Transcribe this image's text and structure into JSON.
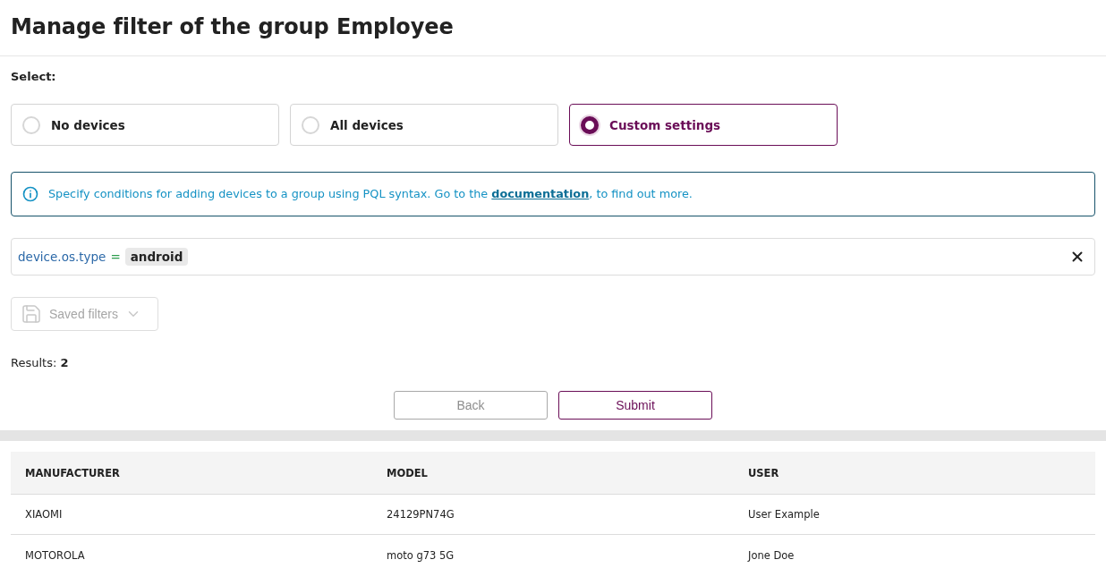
{
  "title": "Manage filter of the group Employee",
  "select_label": "Select:",
  "options": [
    {
      "label": "No devices",
      "selected": false
    },
    {
      "label": "All devices",
      "selected": false
    },
    {
      "label": "Custom settings",
      "selected": true
    }
  ],
  "info": {
    "text_before": "Specify conditions for adding devices to a group using PQL syntax. Go to the ",
    "link": "documentation",
    "text_after": ", to find out more."
  },
  "query": {
    "key": "device.os.type",
    "operator": "=",
    "value": "android"
  },
  "saved_filters": {
    "label": "Saved filters",
    "disabled": true
  },
  "results": "Results: **2**",
  "buttons": [
    {
      "label": "Back",
      "disabled": true
    },
    {
      "label": "Submit",
      "disabled": false
    }
  ],
  "table": {
    "columns": [
      "MANUFACTURER",
      "MODEL",
      "USER"
    ],
    "rows": [
      [
        "XIAOMI",
        "24129PN74G",
        "User Example"
      ],
      [
        "MOTOROLA",
        "moto g73 5G",
        "Jone Doe"
      ]
    ]
  }
}
